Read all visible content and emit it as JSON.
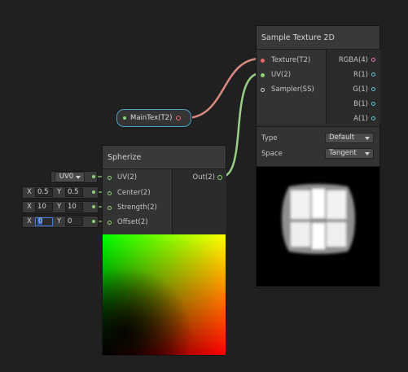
{
  "colors": {
    "canvas": "#202020",
    "texture_port": "#e36a6a",
    "uv_port": "#8fd07a",
    "wire_texture": "#d98a83",
    "wire_vector": "#99cf87",
    "property_border": "#4aa1c9"
  },
  "property_node": {
    "label": "MainTex(T2)"
  },
  "sample_texture": {
    "title": "Sample Texture 2D",
    "inputs": [
      "Texture(T2)",
      "UV(2)",
      "Sampler(SS)"
    ],
    "outputs": [
      "RGBA(4)",
      "R(1)",
      "G(1)",
      "B(1)",
      "A(1)"
    ],
    "type_label": "Type",
    "type_value": "Default",
    "space_label": "Space",
    "space_value": "Tangent"
  },
  "spherize": {
    "title": "Spherize",
    "inputs": [
      "UV(2)",
      "Center(2)",
      "Strength(2)",
      "Offset(2)"
    ],
    "output": "Out(2)"
  },
  "inline_inputs": {
    "uv_channel": "UV0",
    "center": {
      "x_label": "X",
      "x": "0.5",
      "y_label": "Y",
      "y": "0.5"
    },
    "strength": {
      "x_label": "X",
      "x": "10",
      "y_label": "Y",
      "y": "10"
    },
    "offset": {
      "x_label": "X",
      "x": "0",
      "y_label": "Y",
      "y": "0"
    }
  }
}
